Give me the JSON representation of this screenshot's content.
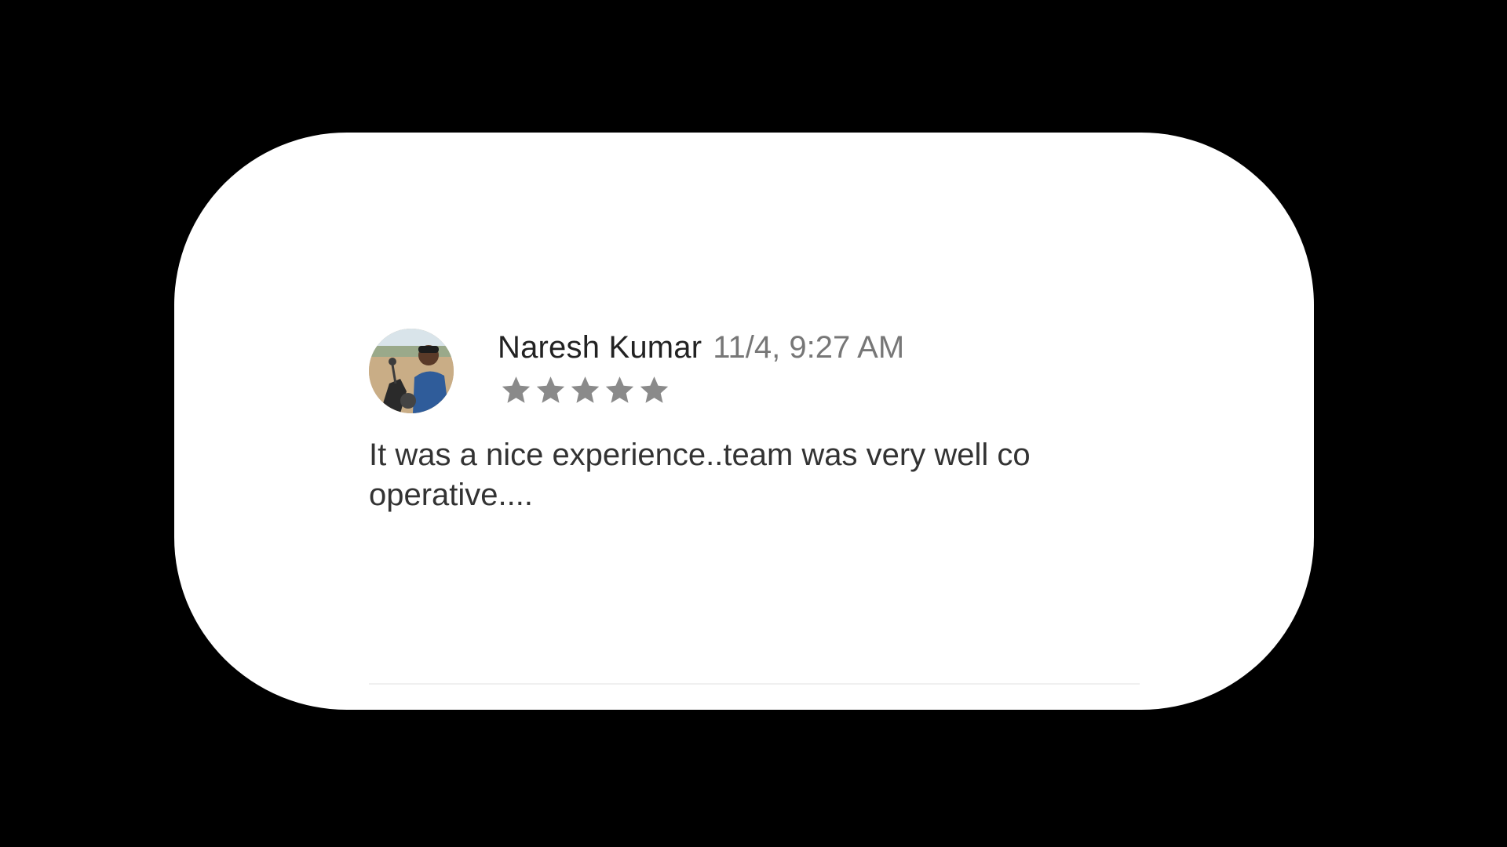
{
  "review": {
    "author": "Naresh Kumar",
    "timestamp": "11/4, 9:27 AM",
    "rating": 5,
    "max_rating": 5,
    "text": "It was a nice experience..team was very well co operative...."
  },
  "colors": {
    "background": "#000000",
    "card": "#ffffff",
    "star": "#8a8a8a",
    "author": "#222222",
    "timestamp": "#777777"
  },
  "icons": [
    "avatar-photo",
    "star-icon"
  ]
}
